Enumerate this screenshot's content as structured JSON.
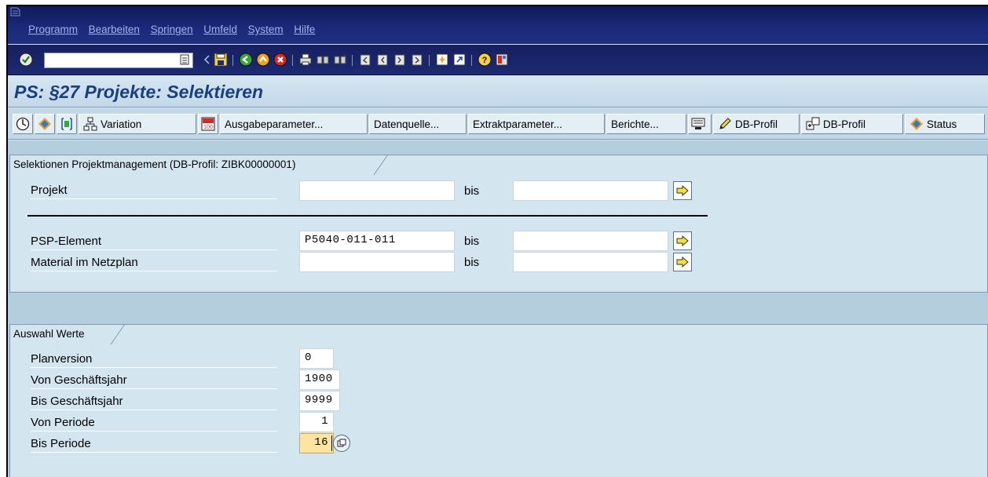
{
  "menubar": {
    "items": [
      "Programm",
      "Bearbeiten",
      "Springen",
      "Umfeld",
      "System",
      "Hilfe"
    ]
  },
  "toolbar": {
    "command_value": "",
    "icons": [
      "enter-icon",
      "command-history-icon",
      "back-arrow-icon",
      "save-icon",
      "back-icon",
      "exit-icon",
      "cancel-icon",
      "print-icon",
      "find-icon",
      "find-next-icon",
      "first-page-icon",
      "previous-page-icon",
      "next-page-icon",
      "last-page-icon",
      "create-session-icon",
      "shortcut-icon",
      "help-icon",
      "layout-icon"
    ]
  },
  "title": "PS: §27 Projekte: Selektieren",
  "app_toolbar": {
    "variation": "Variation",
    "ausgabeparameter": "Ausgabeparameter...",
    "datenquelle": "Datenquelle...",
    "extraktparameter": "Extraktparameter...",
    "berichte": "Berichte...",
    "db_profil_1": "DB-Profil",
    "db_profil_2": "DB-Profil",
    "status": "Status"
  },
  "selektionen": {
    "title": "Selektionen Projektmanagement (DB-Profil: ZIBK00000001)",
    "rows": [
      {
        "label": "Projekt",
        "from": "",
        "bis": "bis",
        "to": ""
      },
      {
        "label": "PSP-Element",
        "from": "P5040-011-011",
        "bis": "bis",
        "to": ""
      },
      {
        "label": "Material im Netzplan",
        "from": "",
        "bis": "bis",
        "to": ""
      }
    ]
  },
  "auswahl": {
    "title": "Auswahl Werte",
    "rows": [
      {
        "label": "Planversion",
        "value": "0"
      },
      {
        "label": "Von Geschäftsjahr",
        "value": "1900"
      },
      {
        "label": "Bis Geschäftsjahr",
        "value": "9999"
      },
      {
        "label": "Von Periode",
        "value": "1"
      },
      {
        "label": "Bis Periode",
        "value": "16"
      }
    ]
  },
  "colors": {
    "menubar": "#1b2a7a",
    "title_text": "#1a3f7d",
    "group_bg": "#d3e6f0",
    "active_field": "#fde4a2"
  }
}
